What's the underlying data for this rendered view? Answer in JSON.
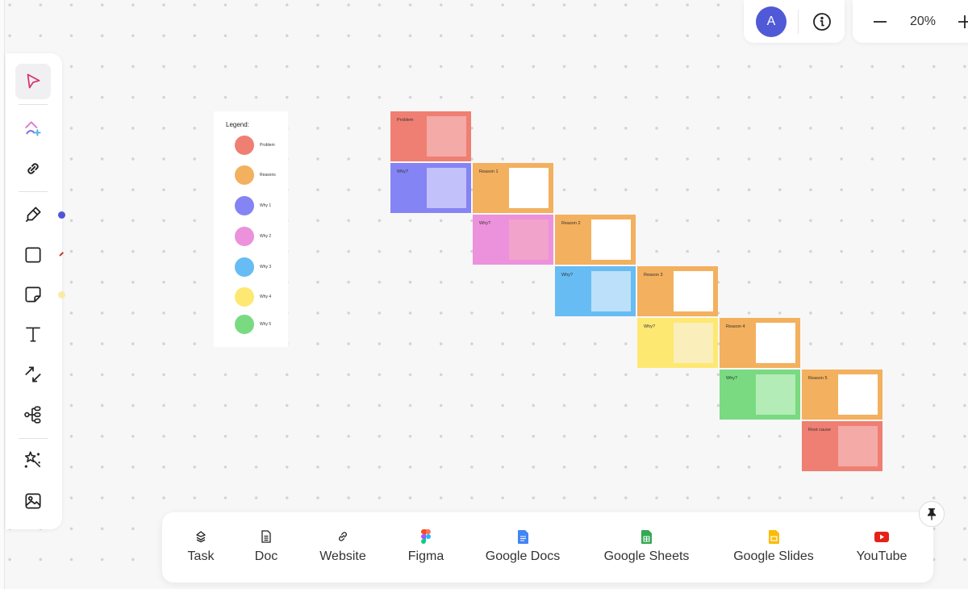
{
  "top_bar": {
    "avatar_initial": "A",
    "info_icon": "info-circle-icon",
    "zoom": {
      "minus_icon": "minus-icon",
      "value": "20%",
      "plus_icon": "plus-icon"
    }
  },
  "toolbar": {
    "tools": [
      {
        "name": "select",
        "icon": "cursor-arrow-icon",
        "active": true
      },
      {
        "name": "clickup-ai",
        "icon": "clickup-logo-plus-icon"
      },
      {
        "name": "link",
        "icon": "link-icon"
      },
      {
        "name": "pen",
        "icon": "pen-icon",
        "color_dot": "#4f55d9"
      },
      {
        "name": "shape",
        "icon": "square-icon",
        "color_dot": "#c0392b"
      },
      {
        "name": "sticky-note",
        "icon": "sticky-note-icon",
        "color_dot": "#fbe9a6"
      },
      {
        "name": "text",
        "icon": "text-T-icon"
      },
      {
        "name": "connector",
        "icon": "connector-arrows-icon"
      },
      {
        "name": "mind-map",
        "icon": "mind-map-icon"
      },
      {
        "name": "ai-magic",
        "icon": "magic-wand-icon"
      },
      {
        "name": "image",
        "icon": "image-icon"
      }
    ]
  },
  "legend": {
    "title": "Legend:",
    "items": [
      {
        "label": "Problem",
        "color": "#ef7f72"
      },
      {
        "label": "Reasons",
        "color": "#f3b05e"
      },
      {
        "label": "Why 1",
        "color": "#8584f4"
      },
      {
        "label": "Why 2",
        "color": "#ec91db"
      },
      {
        "label": "Why 3",
        "color": "#66bcf3"
      },
      {
        "label": "Why 4",
        "color": "#fde872"
      },
      {
        "label": "Why 5",
        "color": "#7ada81"
      }
    ]
  },
  "cards": [
    {
      "label": "Problem",
      "color": "#ef7f72",
      "inner": "#f4aaa6"
    },
    {
      "label": "Why?",
      "color": "#8584f4",
      "inner": "#c2c1fa"
    },
    {
      "label": "Reason 1",
      "color": "#f3b05e",
      "inner": "#ffffff"
    },
    {
      "label": "Why?",
      "color": "#ec91db",
      "inner": "#f2a3cb"
    },
    {
      "label": "Reason 2",
      "color": "#f3b05e",
      "inner": "#ffffff"
    },
    {
      "label": "Why?",
      "color": "#66bcf3",
      "inner": "#bde0fa"
    },
    {
      "label": "Reason 3",
      "color": "#f3b05e",
      "inner": "#ffffff"
    },
    {
      "label": "Why?",
      "color": "#fde872",
      "inner": "#faeebb"
    },
    {
      "label": "Reason 4",
      "color": "#f3b05e",
      "inner": "#ffffff"
    },
    {
      "label": "Why?",
      "color": "#7ada81",
      "inner": "#b3ecb7"
    },
    {
      "label": "Reason 5",
      "color": "#f3b05e",
      "inner": "#ffffff"
    },
    {
      "label": "Root cause",
      "color": "#ef7f72",
      "inner": "#f4aaa6"
    }
  ],
  "bottom_bar": {
    "items": [
      {
        "label": "Task",
        "icon": "task-layers-icon"
      },
      {
        "label": "Doc",
        "icon": "doc-icon"
      },
      {
        "label": "Website",
        "icon": "link-icon"
      },
      {
        "label": "Figma",
        "icon": "figma-icon"
      },
      {
        "label": "Google Docs",
        "icon": "google-docs-icon"
      },
      {
        "label": "Google Sheets",
        "icon": "google-sheets-icon"
      },
      {
        "label": "Google Slides",
        "icon": "google-slides-icon"
      },
      {
        "label": "YouTube",
        "icon": "youtube-icon"
      }
    ],
    "pin_icon": "pin-icon"
  }
}
